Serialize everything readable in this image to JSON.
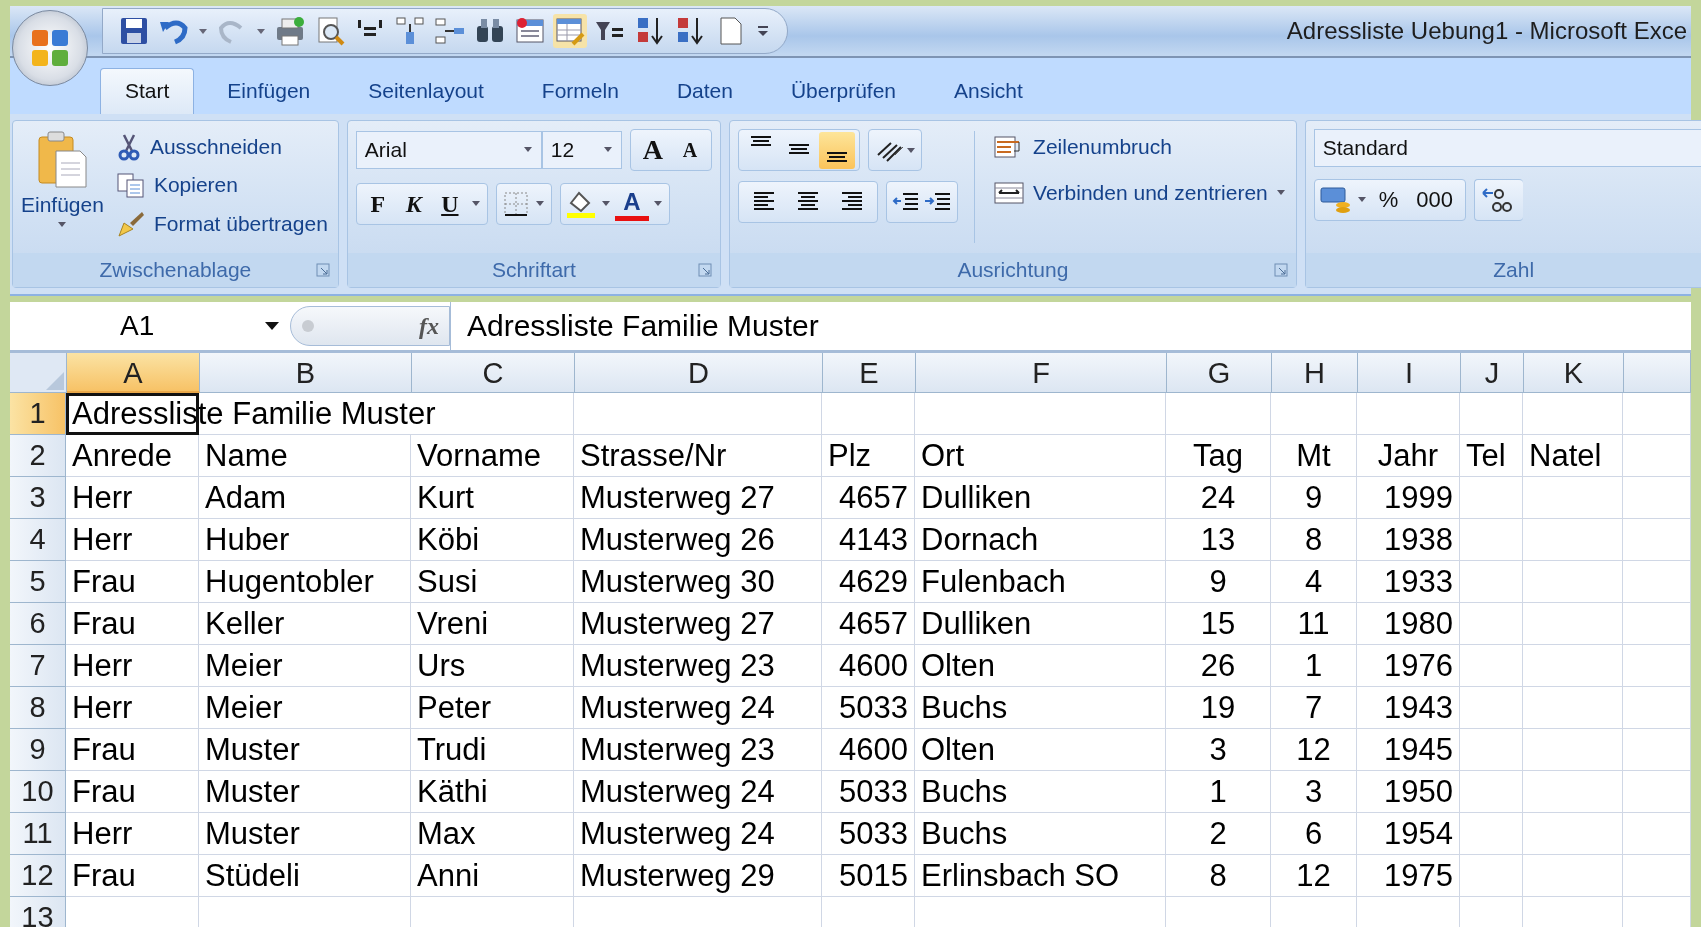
{
  "window": {
    "title": "Adressliste Uebung1  -  Microsoft Exce"
  },
  "tabs": [
    {
      "label": "Start",
      "selected": true
    },
    {
      "label": "Einfügen",
      "selected": false
    },
    {
      "label": "Seitenlayout",
      "selected": false
    },
    {
      "label": "Formeln",
      "selected": false
    },
    {
      "label": "Daten",
      "selected": false
    },
    {
      "label": "Überprüfen",
      "selected": false
    },
    {
      "label": "Ansicht",
      "selected": false
    }
  ],
  "clipboard": {
    "paste": "Einfügen",
    "items": [
      "Ausschneiden",
      "Kopieren",
      "Format übertragen"
    ],
    "label": "Zwischenablage"
  },
  "font": {
    "name": "Arial",
    "size": "12",
    "grow": "A",
    "shrink": "A",
    "styles": [
      {
        "kind": "bold",
        "label": "F"
      },
      {
        "kind": "italic",
        "label": "K"
      },
      {
        "kind": "underline",
        "label": "U"
      }
    ],
    "color_letter": "A",
    "label": "Schriftart"
  },
  "alignment": {
    "vertical": [
      {
        "selected": false
      },
      {
        "selected": false
      },
      {
        "selected": true
      }
    ],
    "horizontal": [
      {
        "selected": false
      },
      {
        "selected": false
      },
      {
        "selected": false
      }
    ],
    "wrap": "Zeilenumbruch",
    "merge": "Verbinden und zentrieren",
    "label": "Ausrichtung"
  },
  "number": {
    "format": "Standard",
    "percent": "%",
    "thousands": "000",
    "label": "Zahl"
  },
  "formula_bar": {
    "name_box": "A1",
    "fx": "fx",
    "value": "Adressliste Familie Muster"
  },
  "sheet": {
    "columns": [
      {
        "label": "A",
        "selected": true
      },
      {
        "label": "B",
        "selected": false
      },
      {
        "label": "C",
        "selected": false
      },
      {
        "label": "D",
        "selected": false
      },
      {
        "label": "E",
        "selected": false
      },
      {
        "label": "F",
        "selected": false
      },
      {
        "label": "G",
        "selected": false
      },
      {
        "label": "H",
        "selected": false
      },
      {
        "label": "I",
        "selected": false
      },
      {
        "label": "J",
        "selected": false
      },
      {
        "label": "K",
        "selected": false
      }
    ],
    "rows": [
      {
        "number": "1",
        "selected": true,
        "cells": [
          "Adressliste Familie Muster"
        ]
      },
      {
        "number": "2",
        "selected": false,
        "cells": [
          "Anrede",
          "Name",
          "Vorname",
          "Strasse/Nr",
          "Plz",
          "Ort",
          "Tag",
          "Mt",
          "Jahr",
          "Tel",
          "Natel"
        ]
      },
      {
        "number": "3",
        "selected": false,
        "cells": [
          "Herr",
          "Adam",
          "Kurt",
          "Musterweg 27",
          "4657",
          "Dulliken",
          "24",
          "9",
          "1999"
        ]
      },
      {
        "number": "4",
        "selected": false,
        "cells": [
          "Herr",
          "Huber",
          "Köbi",
          "Musterweg 26",
          "4143",
          "Dornach",
          "13",
          "8",
          "1938"
        ]
      },
      {
        "number": "5",
        "selected": false,
        "cells": [
          "Frau",
          "Hugentobler",
          "Susi",
          "Musterweg 30",
          "4629",
          "Fulenbach",
          "9",
          "4",
          "1933"
        ]
      },
      {
        "number": "6",
        "selected": false,
        "cells": [
          "Frau",
          "Keller",
          "Vreni",
          "Musterweg 27",
          "4657",
          "Dulliken",
          "15",
          "11",
          "1980"
        ]
      },
      {
        "number": "7",
        "selected": false,
        "cells": [
          "Herr",
          "Meier",
          "Urs",
          "Musterweg 23",
          "4600",
          "Olten",
          "26",
          "1",
          "1976"
        ]
      },
      {
        "number": "8",
        "selected": false,
        "cells": [
          "Herr",
          "Meier",
          "Peter",
          "Musterweg 24",
          "5033",
          "Buchs",
          "19",
          "7",
          "1943"
        ]
      },
      {
        "number": "9",
        "selected": false,
        "cells": [
          "Frau",
          "Muster",
          "Trudi",
          "Musterweg 23",
          "4600",
          "Olten",
          "3",
          "12",
          "1945"
        ]
      },
      {
        "number": "10",
        "selected": false,
        "cells": [
          "Frau",
          "Muster",
          "Käthi",
          "Musterweg 24",
          "5033",
          "Buchs",
          "1",
          "3",
          "1950"
        ]
      },
      {
        "number": "11",
        "selected": false,
        "cells": [
          "Herr",
          "Muster",
          "Max",
          "Musterweg 24",
          "5033",
          "Buchs",
          "2",
          "6",
          "1954"
        ]
      },
      {
        "number": "12",
        "selected": false,
        "cells": [
          "Frau",
          "Stüdeli",
          "Anni",
          "Musterweg 29",
          "5015",
          "Erlinsbach SO",
          "8",
          "12",
          "1975"
        ]
      },
      {
        "number": "13",
        "selected": false,
        "cells": []
      }
    ]
  }
}
